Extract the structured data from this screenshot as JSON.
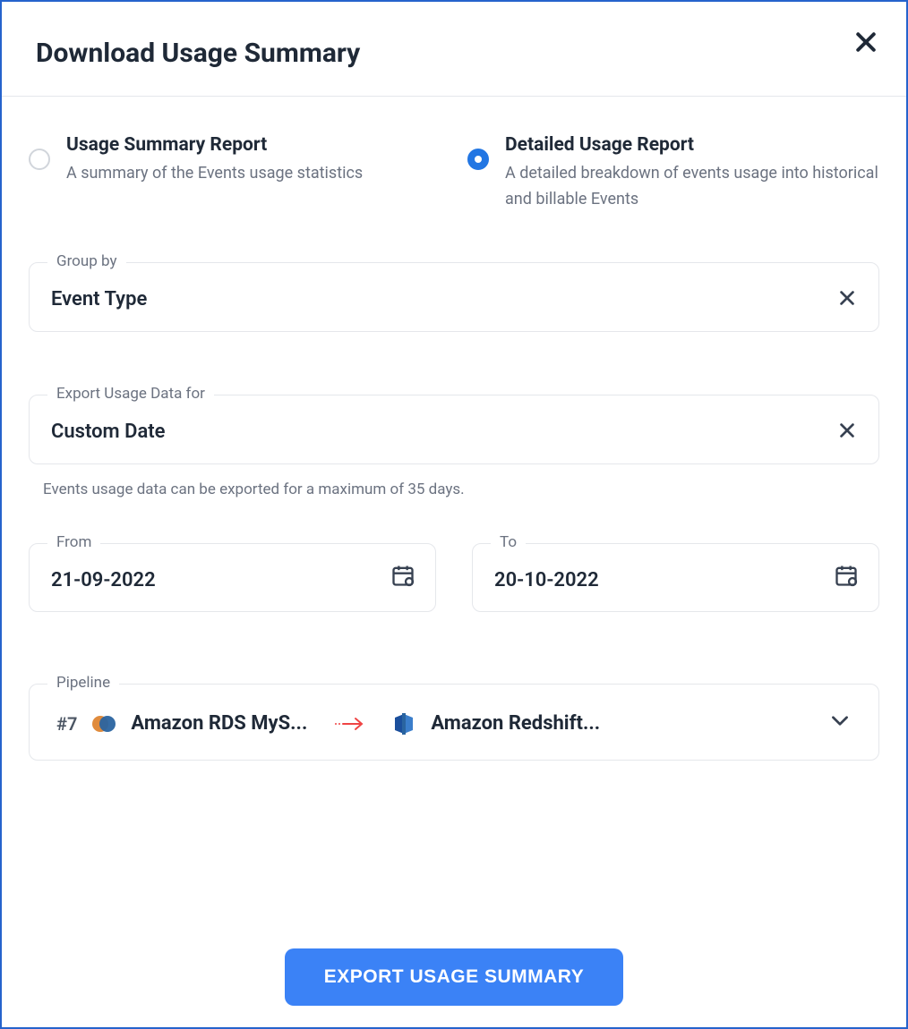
{
  "header": {
    "title": "Download Usage Summary"
  },
  "reportOptions": {
    "summary": {
      "title": "Usage Summary Report",
      "desc": "A summary of the Events usage statistics",
      "selected": false
    },
    "detailed": {
      "title": "Detailed Usage Report",
      "desc": "A detailed breakdown of events usage into historical and billable Events",
      "selected": true
    }
  },
  "groupBy": {
    "label": "Group by",
    "value": "Event Type"
  },
  "exportFor": {
    "label": "Export Usage Data for",
    "value": "Custom Date",
    "helper": "Events usage data can be exported for a maximum of 35 days."
  },
  "dates": {
    "fromLabel": "From",
    "fromValue": "21-09-2022",
    "toLabel": "To",
    "toValue": "20-10-2022"
  },
  "pipeline": {
    "label": "Pipeline",
    "id": "#7",
    "source": "Amazon RDS MyS...",
    "destination": "Amazon Redshift..."
  },
  "footer": {
    "button": "EXPORT USAGE SUMMARY"
  }
}
